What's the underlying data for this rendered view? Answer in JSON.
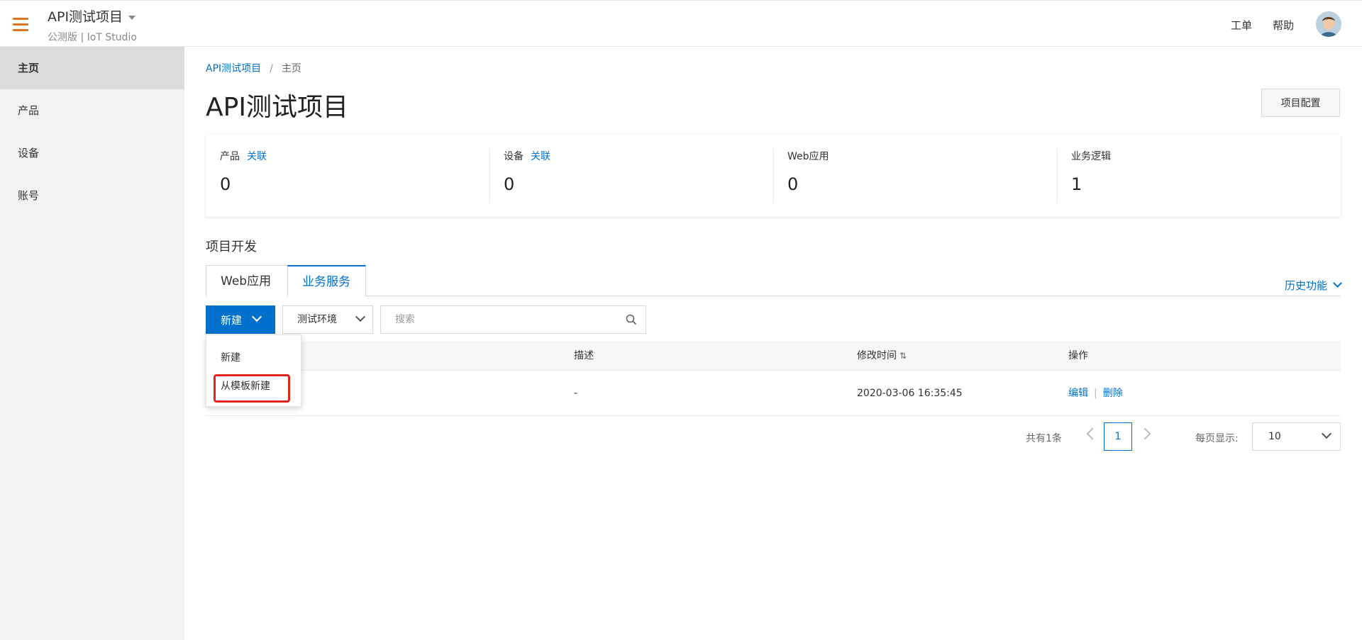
{
  "header": {
    "project_title": "API测试项目",
    "project_subtitle": "公测版 | IoT Studio",
    "links": [
      "工单",
      "帮助"
    ]
  },
  "sidebar": {
    "items": [
      {
        "label": "主页",
        "active": true
      },
      {
        "label": "产品"
      },
      {
        "label": "设备"
      },
      {
        "label": "账号"
      }
    ]
  },
  "breadcrumb": {
    "root": "API测试项目",
    "separator": "/",
    "current": "主页"
  },
  "page": {
    "title": "API测试项目",
    "config_button": "项目配置"
  },
  "stats": [
    {
      "label": "产品",
      "link": "关联",
      "value": "0"
    },
    {
      "label": "设备",
      "link": "关联",
      "value": "0"
    },
    {
      "label": "Web应用",
      "value": "0"
    },
    {
      "label": "业务逻辑",
      "value": "1"
    }
  ],
  "dev": {
    "section_title": "项目开发",
    "tabs": [
      {
        "label": "Web应用"
      },
      {
        "label": "业务服务",
        "active": true
      }
    ],
    "history": "历史功能"
  },
  "toolbar": {
    "new_label": "新建",
    "env_label": "测试环境",
    "search_placeholder": "搜索"
  },
  "dropdown": {
    "items": [
      "新建",
      "从模板新建"
    ]
  },
  "table": {
    "columns": [
      "描述",
      "修改时间",
      "操作"
    ],
    "rows": [
      {
        "description": "-",
        "modified": "2020-03-06 16:35:45",
        "actions": [
          "编辑",
          "删除"
        ]
      }
    ]
  },
  "pagination": {
    "total": "共有1条",
    "current_page": "1",
    "per_page_label": "每页显示:",
    "per_page_value": "10"
  },
  "colors": {
    "accent": "#0070cc",
    "menu_icon": "#e0731b",
    "highlight_border": "#e0251b"
  }
}
